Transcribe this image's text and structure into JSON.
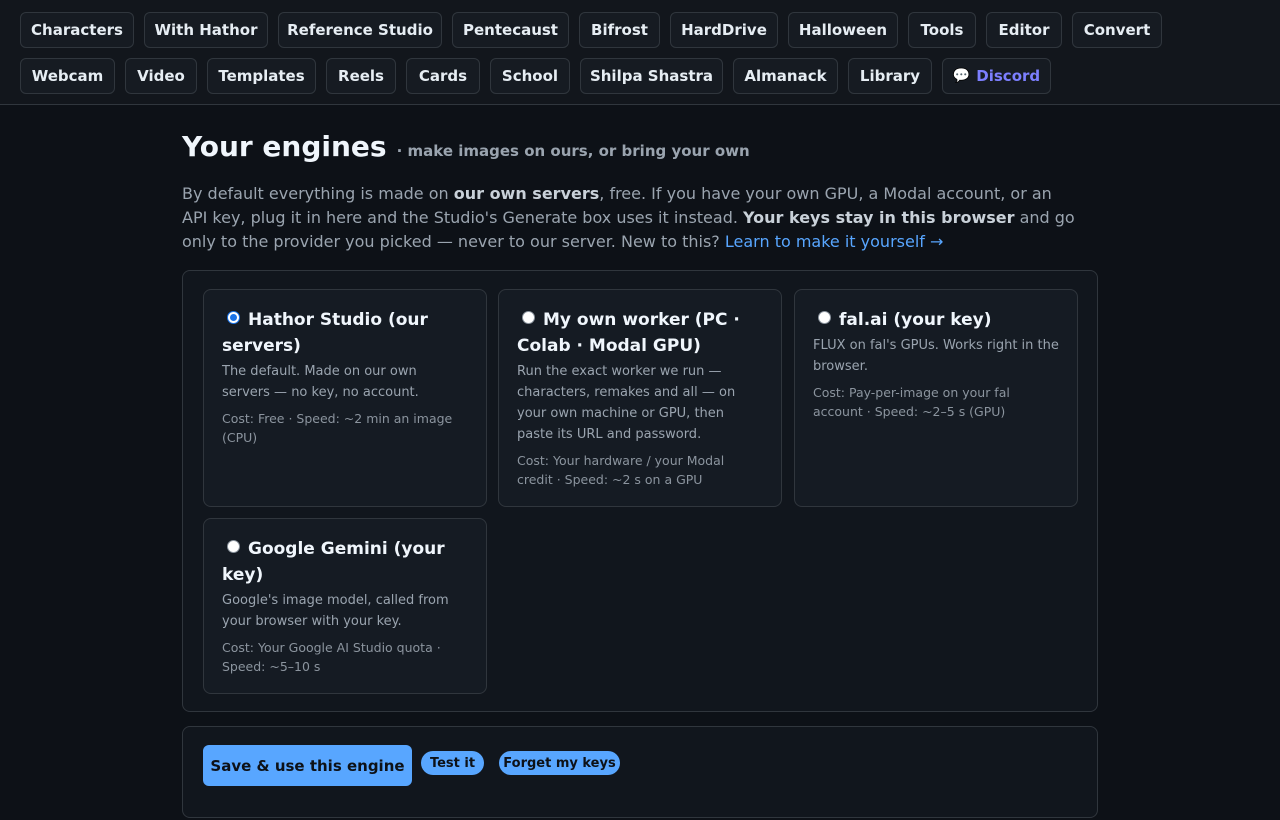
{
  "nav": {
    "row1": [
      "Characters",
      "With Hathor",
      "Reference Studio",
      "Pentecaust",
      "Bifrost",
      "HardDrive",
      "Halloween",
      "Tools",
      "Editor",
      "Convert"
    ],
    "row2": [
      "Webcam",
      "Video",
      "Templates",
      "Reels",
      "Cards",
      "School",
      "Shilpa Shastra",
      "Almanack",
      "Library"
    ],
    "discord": {
      "icon": "speech-bubble-icon",
      "glyph": "💬",
      "label": "Discord",
      "color": "#7c7fff"
    }
  },
  "page": {
    "title": "Your engines",
    "subtitle": "· make images on ours, or bring your own",
    "intro": {
      "p1": "By default everything is made on ",
      "b1": "our own servers",
      "p2": ", free. If you have your own GPU, a Modal account, or an API key, plug it in here and the Studio's Generate box uses it instead. ",
      "b2": "Your keys stay in this browser",
      "p3": " and go only to the provider you picked — never to our server. New to this? ",
      "link": "Learn to make it yourself →"
    }
  },
  "engines": [
    {
      "title": "Hathor Studio (our servers)",
      "selected": true,
      "desc": "The default. Made on our own servers — no key, no account.",
      "cost": "Cost: Free · Speed: ~2 min an image (CPU)"
    },
    {
      "title": "My own worker (PC · Colab · Modal GPU)",
      "selected": false,
      "desc": "Run the exact worker we run — characters, remakes and all — on your own machine or GPU, then paste its URL and password.",
      "cost": "Cost: Your hardware / your Modal credit · Speed: ~2 s on a GPU"
    },
    {
      "title": "fal.ai (your key)",
      "selected": false,
      "desc": "FLUX on fal's GPUs. Works right in the browser.",
      "cost": "Cost: Pay-per-image on your fal account · Speed: ~2–5 s (GPU)"
    },
    {
      "title": "Google Gemini (your key)",
      "selected": false,
      "desc": "Google's image model, called from your browser with your key.",
      "cost": "Cost: Your Google AI Studio quota · Speed: ~5–10 s"
    }
  ],
  "actions": {
    "save": "Save & use this engine",
    "test": "Test it",
    "forget": "Forget my keys"
  },
  "colors": {
    "accent": "#58a6ff",
    "background": "#0d1117",
    "radio_selected": "#1a73e8"
  }
}
